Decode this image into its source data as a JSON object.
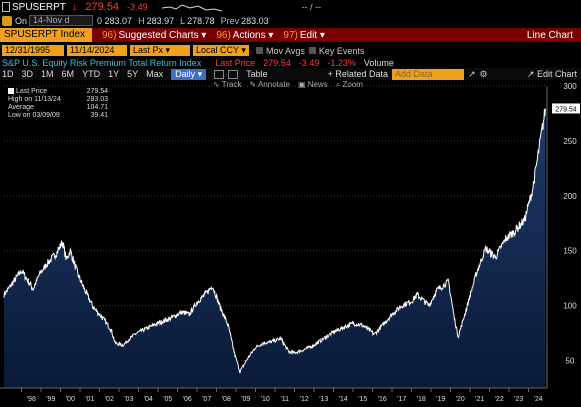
{
  "header": {
    "ticker": "SPUSERPT",
    "last_price": "279.54",
    "change": "-3.49",
    "dash": "-- / --"
  },
  "quote": {
    "on_label": "On",
    "date": "14-Nov d",
    "open": "0 283.07",
    "high_label": "H",
    "high": "283.97",
    "low_label": "L",
    "low": "278.78",
    "prev_label": "Prev",
    "prev": "283.03"
  },
  "toolbar": {
    "security": "SPUSERPT Index",
    "suggested_num": "96)",
    "suggested": "Suggested Charts",
    "actions_num": "96)",
    "actions": "Actions",
    "edit_num": "97)",
    "edit": "Edit",
    "chart_type": "Line Chart"
  },
  "range": {
    "start": "12/31/1995",
    "end": "11/14/2024",
    "field": "Last Px",
    "currency": "Local CCY",
    "mov_avgs": "Mov Avgs",
    "key_events": "Key Events"
  },
  "series": {
    "name": "S&P U.S. Equity Risk Premium Total Return Index",
    "last_price_label": "Last Price",
    "last_price": "279.54",
    "change": "-3.49",
    "pct": "-1.23%",
    "volume": "Volume"
  },
  "periods": [
    "1D",
    "3D",
    "1M",
    "6M",
    "YTD",
    "1Y",
    "5Y",
    "Max"
  ],
  "period_selected": "Daily",
  "table_label": "Table",
  "related_data": "+ Related Data",
  "add_data_placeholder": "Add Data",
  "edit_chart": "Edit Chart",
  "chart_tools": [
    "Track",
    "Annotate",
    "News",
    "Zoom"
  ],
  "legend": {
    "last_price_label": "Last Price",
    "last_price": "279.54",
    "high_label": "High on 11/13/24",
    "high": "283.03",
    "avg_label": "Average",
    "avg": "104.71",
    "low_label": "Low on 03/09/09",
    "low": "39.41"
  },
  "chart_data": {
    "type": "area",
    "title": "S&P U.S. Equity Risk Premium Total Return Index",
    "ylim": [
      25,
      300
    ],
    "yticks": [
      50,
      100,
      150,
      200,
      250,
      300
    ],
    "xticks": [
      "'98",
      "'99",
      "'00",
      "'01",
      "'02",
      "'03",
      "'04",
      "'05",
      "'06",
      "'07",
      "'08",
      "'09",
      "'10",
      "'11",
      "'12",
      "'13",
      "'14",
      "'15",
      "'16",
      "'17",
      "'18",
      "'19",
      "'20",
      "'21",
      "'22",
      "'23",
      "'24"
    ],
    "xlim": [
      1997.1,
      2024.95
    ],
    "current_label": "279.54",
    "series": [
      {
        "name": "Last Price",
        "x": [
          1997.1,
          1997.6,
          1998.0,
          1998.6,
          1998.9,
          1999.3,
          1999.8,
          2000.1,
          2000.3,
          2000.5,
          2000.9,
          2001.3,
          2001.7,
          2002.2,
          2002.6,
          2002.8,
          2003.2,
          2003.8,
          2004.5,
          2005.0,
          2005.6,
          2006.2,
          2006.6,
          2007.0,
          2007.4,
          2007.8,
          2008.2,
          2008.6,
          2008.9,
          2009.2,
          2009.6,
          2010.0,
          2010.4,
          2010.8,
          2011.3,
          2011.7,
          2012.0,
          2012.5,
          2013.0,
          2013.5,
          2014.0,
          2014.5,
          2015.0,
          2015.5,
          2016.1,
          2016.6,
          2017.0,
          2017.5,
          2018.0,
          2018.3,
          2018.9,
          2019.3,
          2019.9,
          2020.2,
          2020.4,
          2020.8,
          2021.3,
          2021.8,
          2022.3,
          2022.8,
          2023.3,
          2023.8,
          2024.2,
          2024.5,
          2024.87
        ],
        "values": [
          110,
          122,
          132,
          115,
          128,
          138,
          148,
          158,
          142,
          150,
          128,
          112,
          98,
          88,
          78,
          66,
          64,
          74,
          80,
          84,
          88,
          94,
          92,
          103,
          110,
          118,
          98,
          82,
          58,
          40,
          52,
          62,
          66,
          67,
          70,
          58,
          57,
          60,
          64,
          70,
          76,
          80,
          84,
          82,
          74,
          84,
          92,
          100,
          104,
          110,
          100,
          114,
          122,
          88,
          72,
          96,
          128,
          152,
          144,
          160,
          168,
          178,
          205,
          238,
          279.54
        ]
      }
    ]
  }
}
